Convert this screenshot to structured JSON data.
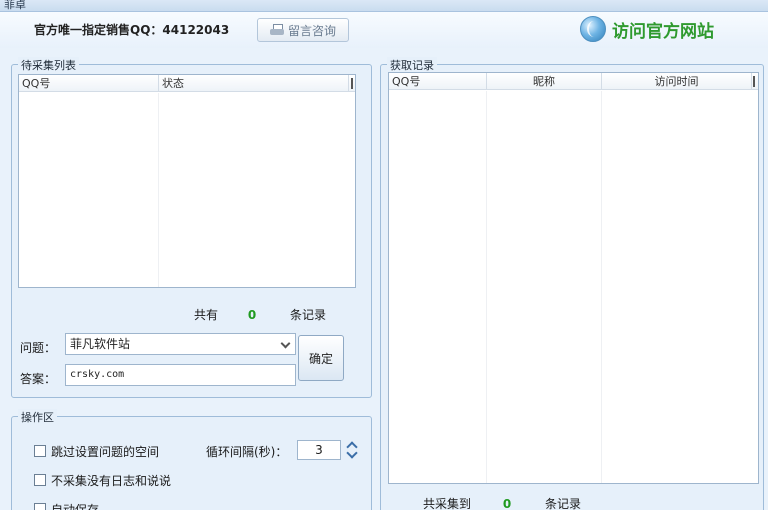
{
  "window": {
    "title": "菲卓"
  },
  "header": {
    "official_text": "官方唯一指定销售QQ：44122043",
    "message_button": "留言咨询",
    "visit_link": "访问官方网站"
  },
  "pending": {
    "title": "待采集列表",
    "columns": [
      "QQ号",
      "状态"
    ],
    "count_prefix": "共有",
    "count": "0",
    "count_suffix": "条记录",
    "question_label": "问题：",
    "question_value": "菲凡软件站",
    "answer_label": "答案：",
    "answer_value": "crsky.com",
    "confirm_button": "确定"
  },
  "operations": {
    "title": "操作区",
    "skip_label": "跳过设置问题的空间",
    "interval_label": "循环间隔(秒)：",
    "interval_value": "3",
    "nolog_label": "不采集没有日志和说说",
    "auto_label": "自动保存"
  },
  "records": {
    "title": "获取记录",
    "columns": [
      "QQ号",
      "昵称",
      "访问时间"
    ],
    "count_prefix": "共采集到",
    "count": "0",
    "count_suffix": "条记录"
  }
}
